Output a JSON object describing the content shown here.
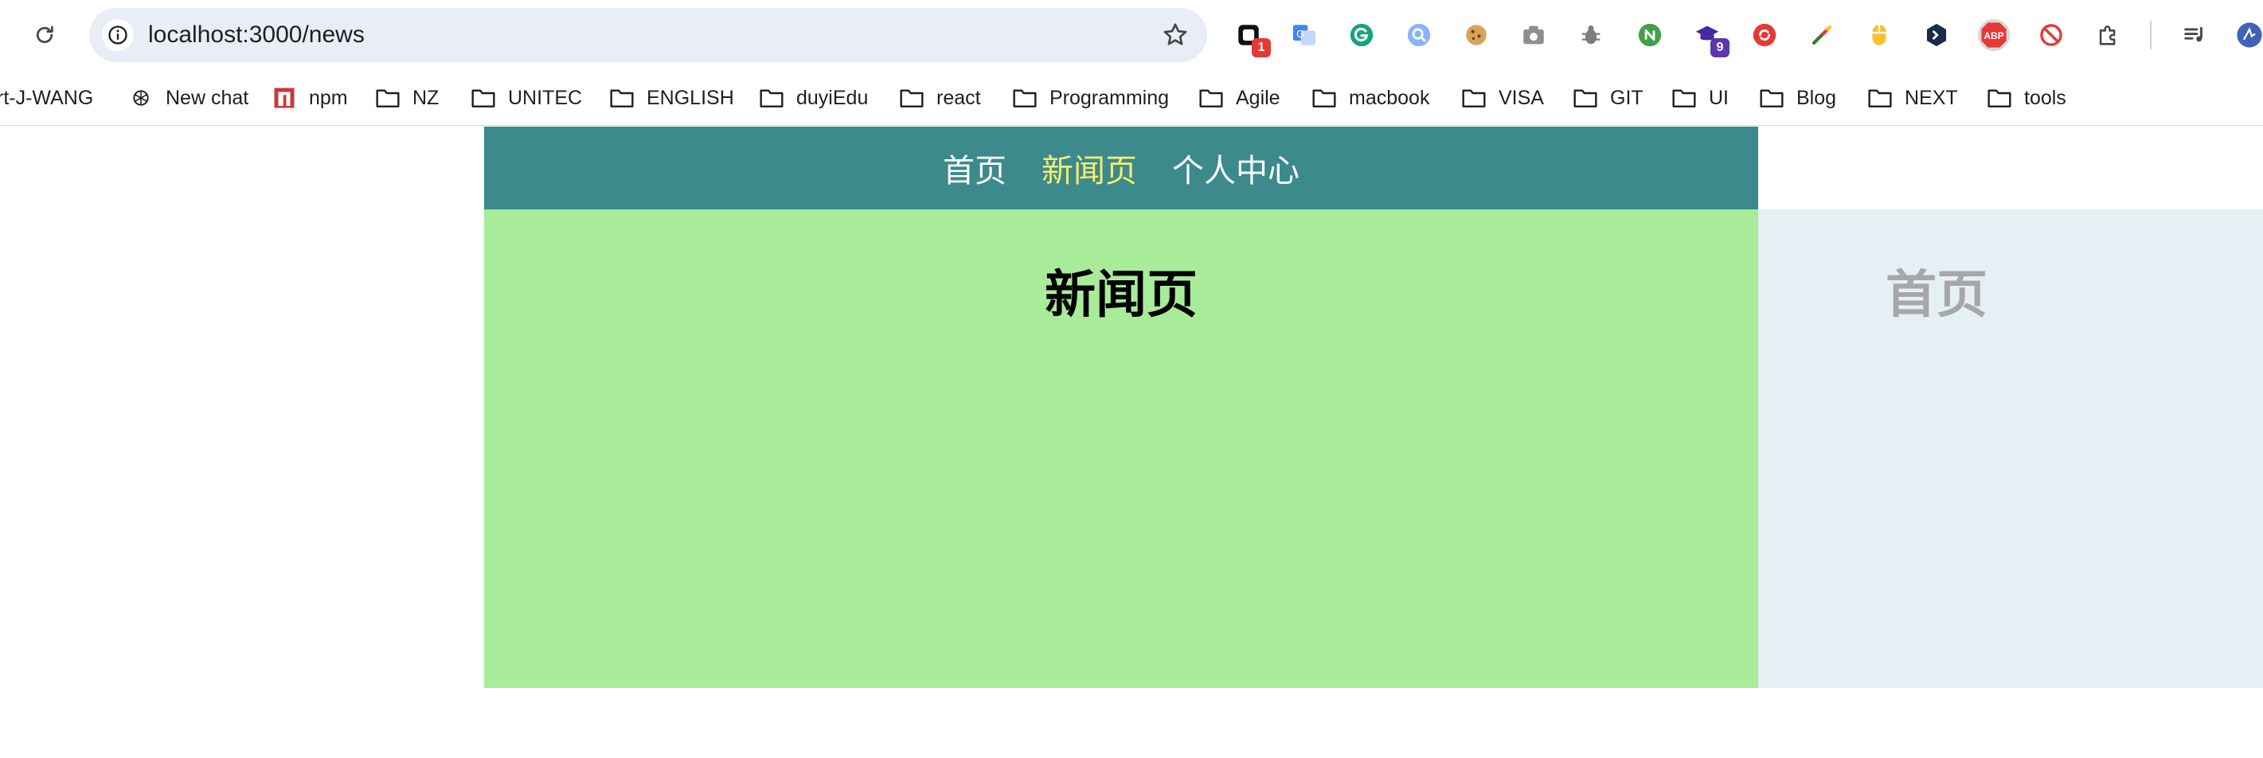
{
  "browser": {
    "url": "localhost:3000/news",
    "extensions": [
      {
        "icon": "notion-ext-icon",
        "badge": "1",
        "badge_color": "#e53935"
      },
      {
        "icon": "google-translate-icon"
      },
      {
        "icon": "grammarly-icon"
      },
      {
        "icon": "magnifier-ext-icon"
      },
      {
        "icon": "cookie-icon"
      },
      {
        "icon": "camera-icon"
      },
      {
        "icon": "bug-icon"
      },
      {
        "icon": "node-icon"
      },
      {
        "icon": "graduation-cap-icon",
        "badge": "9",
        "badge_color": "#5e35b1"
      },
      {
        "icon": "sync-icon"
      },
      {
        "icon": "color-picker-icon"
      },
      {
        "icon": "mouse-icon"
      },
      {
        "icon": "dev-tools-ext-icon"
      },
      {
        "icon": "adblock-plus-icon",
        "label": "ABP"
      },
      {
        "icon": "block-icon"
      },
      {
        "icon": "puzzle-icon"
      },
      {
        "icon": "media-queue-icon"
      },
      {
        "icon": "profile-avatar-icon"
      }
    ]
  },
  "bookmarks": [
    {
      "label": "rt-J-WANG",
      "icon": "none"
    },
    {
      "label": "New chat",
      "icon": "openai-icon"
    },
    {
      "label": "npm",
      "icon": "npm-icon"
    },
    {
      "label": "NZ",
      "icon": "folder-icon"
    },
    {
      "label": "UNITEC",
      "icon": "folder-icon"
    },
    {
      "label": "ENGLISH",
      "icon": "folder-icon"
    },
    {
      "label": "duyiEdu",
      "icon": "folder-icon"
    },
    {
      "label": "react",
      "icon": "folder-icon"
    },
    {
      "label": "Programming",
      "icon": "folder-icon"
    },
    {
      "label": "Agile",
      "icon": "folder-icon"
    },
    {
      "label": "macbook",
      "icon": "folder-icon"
    },
    {
      "label": "VISA",
      "icon": "folder-icon"
    },
    {
      "label": "GIT",
      "icon": "folder-icon"
    },
    {
      "label": "UI",
      "icon": "folder-icon"
    },
    {
      "label": "Blog",
      "icon": "folder-icon"
    },
    {
      "label": "NEXT",
      "icon": "folder-icon"
    },
    {
      "label": "tools",
      "icon": "folder-icon"
    }
  ],
  "app": {
    "nav": [
      {
        "label": "首页",
        "active": false
      },
      {
        "label": "新闻页",
        "active": true
      },
      {
        "label": "个人中心",
        "active": false
      }
    ],
    "main_title": "新闻页",
    "ghost_title": "首页"
  },
  "colors": {
    "nav_bg": "#3c8a8c",
    "nav_active": "#f4ec6e",
    "main_bg": "#a8ec9a",
    "ghost_bg": "#e4f0f4"
  }
}
